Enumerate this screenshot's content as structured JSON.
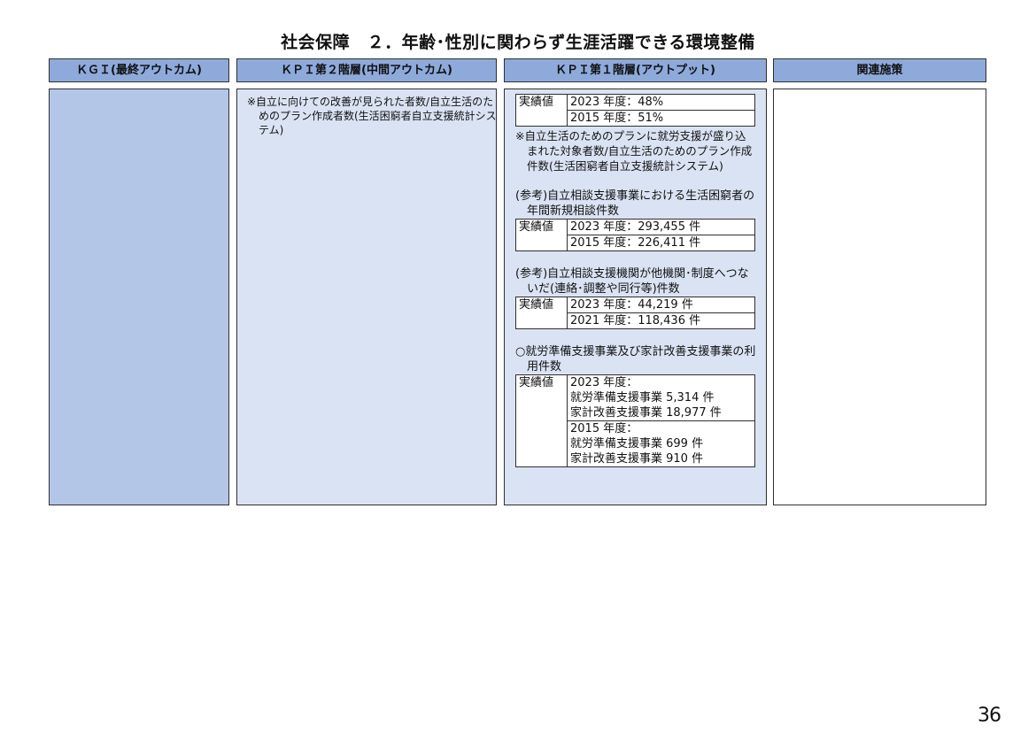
{
  "title": "社会保障　２．年齢･性別に関わらず生涯活躍できる環境整備",
  "headers": {
    "kgi": "ＫＧＩ(最終アウトカム)",
    "kpi2": "ＫＰＩ第２階層(中間アウトカム)",
    "kpi1": "ＫＰＩ第１階層(アウトプット)",
    "policy": "関連施策"
  },
  "kpi2": {
    "text": "※自立に向けての改善が見られた者数/自立生活のためのプラン作成者数(生活困窮者自立支援統計システム)"
  },
  "kpi1": {
    "block1": {
      "label": "実績値",
      "rows": [
        "2023 年度：48%",
        "2015 年度：51%"
      ],
      "note": "※自立生活のためのプランに就労支援が盛り込まれた対象者数/自立生活のためのプラン作成件数(生活困窮者自立支援統計システム)"
    },
    "block2": {
      "heading": "(参考)自立相談支援事業における生活困窮者の年間新規相談件数",
      "label": "実績値",
      "rows": [
        "2023 年度：293,455 件",
        "2015 年度：226,411 件"
      ]
    },
    "block3": {
      "heading": "(参考)自立相談支援機関が他機関･制度へつないだ(連絡･調整や同行等)件数",
      "label": "実績値",
      "rows": [
        "2023 年度：44,219 件",
        "2021 年度：118,436 件"
      ]
    },
    "block4": {
      "heading": "○就労準備支援事業及び家計改善支援事業の利用件数",
      "label": "実績値",
      "row1": {
        "year": "2023 年度：",
        "line1": "就労準備支援事業 5,314 件",
        "line2": "家計改善支援事業 18,977 件"
      },
      "row2": {
        "year": "2015 年度：",
        "line1": "就労準備支援事業 699 件",
        "line2": "家計改善支援事業 910 件"
      }
    }
  },
  "page_number": "36"
}
